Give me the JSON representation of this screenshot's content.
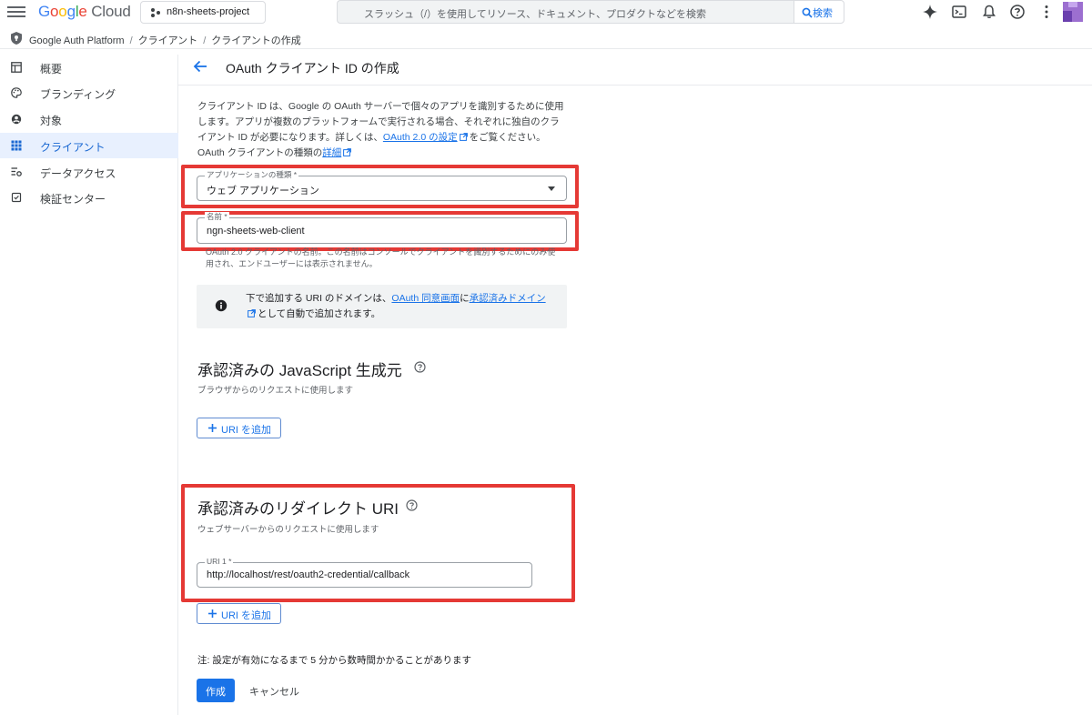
{
  "topbar": {
    "logo_google": [
      "G",
      "o",
      "o",
      "g",
      "l",
      "e"
    ],
    "logo_cloud": "Cloud",
    "project_name": "n8n-sheets-project",
    "search_placeholder": "スラッシュ（/）を使用してリソース、ドキュメント、プロダクトなどを検索",
    "search_button": "検索",
    "icons": [
      "gemini-icon",
      "terminal-icon",
      "bell-icon",
      "help-icon",
      "more-vert-icon",
      "avatar"
    ]
  },
  "breadcrumb": [
    "Google Auth Platform",
    "クライアント",
    "クライアントの作成"
  ],
  "sidebar": {
    "items": [
      {
        "label": "概要",
        "icon": "dashboard-icon"
      },
      {
        "label": "ブランディング",
        "icon": "palette-icon"
      },
      {
        "label": "対象",
        "icon": "person-icon"
      },
      {
        "label": "クライアント",
        "icon": "grid-icon",
        "active": true
      },
      {
        "label": "データアクセス",
        "icon": "settings-list-icon"
      },
      {
        "label": "検証センター",
        "icon": "verified-icon"
      }
    ]
  },
  "page": {
    "title": "OAuth クライアント ID の作成",
    "intro_text": "クライアント ID は、Google の OAuth サーバーで個々のアプリを識別するために使用します。アプリが複数のプラットフォームで実行される場合、それぞれに独自のクライアント ID が必要になります。詳しくは、",
    "intro_link1": "OAuth 2.0 の設定",
    "intro_mid": "をご覧ください。 OAuth クライアントの種類の",
    "intro_link2": "詳細"
  },
  "app_type": {
    "label": "アプリケーションの種類 *",
    "value": "ウェブ アプリケーション"
  },
  "name_field": {
    "label": "名前 *",
    "value": "ngn-sheets-web-client",
    "hint": "OAuth 2.0 クライアントの名前。この名前はコンソールでクライアントを識別するためにのみ使用され、エンドユーザーには表示されません。"
  },
  "info": {
    "text_before": "下で追加する URI のドメインは、",
    "link1": "OAuth 同意画面",
    "text_mid": "に",
    "link2": "承認済みドメイン",
    "text_after": "として自動で追加されます。"
  },
  "js_origins": {
    "title": "承認済みの JavaScript 生成元",
    "subtitle": "ブラウザからのリクエストに使用します",
    "add_button": "URI を追加"
  },
  "redirect_uris": {
    "title": "承認済みのリダイレクト URI",
    "subtitle": "ウェブサーバーからのリクエストに使用します",
    "uri_label": "URI 1 *",
    "uri_value": "http://localhost/rest/oauth2-credential/callback",
    "add_button": "URI を追加"
  },
  "footer": {
    "note": "注: 設定が有効になるまで 5 分から数時間かかることがあります",
    "create_button": "作成",
    "cancel_button": "キャンセル"
  },
  "colors": {
    "accent": "#1a73e8",
    "highlight_box": "#e53935",
    "active_nav_bg": "#e8f0fe"
  }
}
